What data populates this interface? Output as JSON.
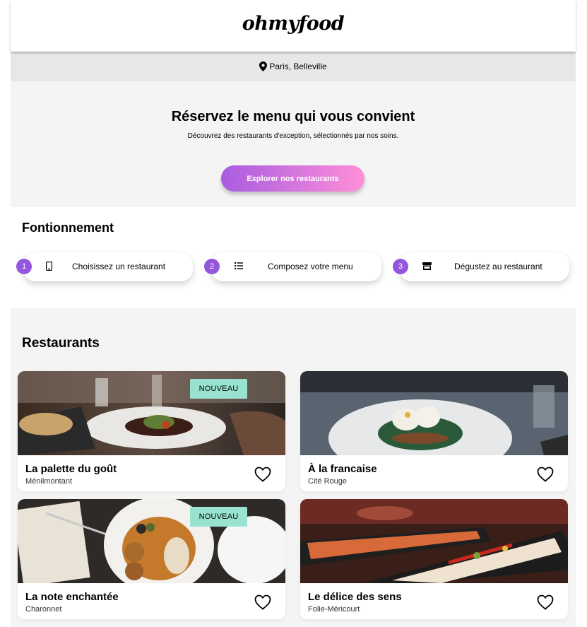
{
  "brand": {
    "logo": "ohmyfood"
  },
  "location": {
    "icon": "map-pin-icon",
    "text": "Paris, Belleville"
  },
  "hero": {
    "title": "Réservez le menu qui vous convient",
    "subtitle": "Découvrez des restaurants d'exception, sélectionnés par nos soins.",
    "cta_label": "Explorer nos restaurants"
  },
  "how": {
    "title": "Fontionnement",
    "steps": [
      {
        "number": "1",
        "icon": "mobile-phone-icon",
        "label": "Choisissez un restaurant"
      },
      {
        "number": "2",
        "icon": "list-icon",
        "label": "Composez votre menu"
      },
      {
        "number": "3",
        "icon": "store-icon",
        "label": "Dégustez au restaurant"
      }
    ]
  },
  "restaurants": {
    "title": "Restaurants",
    "items": [
      {
        "name": "La palette du goût",
        "area": "Ménilmontant",
        "badge": "NOUVEAU",
        "liked": false
      },
      {
        "name": "À la francaise",
        "area": "Cité Rouge",
        "badge": "",
        "liked": false
      },
      {
        "name": "La note enchantée",
        "area": "Charonnet",
        "badge": "NOUVEAU",
        "liked": false
      },
      {
        "name": "Le délice des sens",
        "area": "Folie-Méricourt",
        "badge": "",
        "liked": false
      }
    ]
  },
  "colors": {
    "accent_purple": "#9356dc",
    "gradient_start": "#a95ce0",
    "gradient_end": "#ff8fd9",
    "badge_mint": "#99e2d0",
    "section_bg": "#f4f4f4",
    "location_bg": "#e7e7e7"
  }
}
